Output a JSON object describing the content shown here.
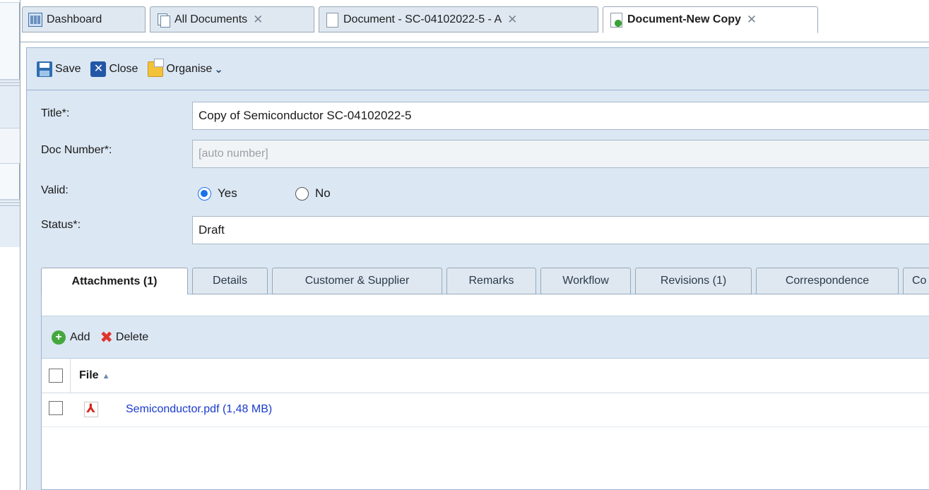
{
  "tabs": [
    {
      "label": "Dashboard",
      "icon": "dashboard-icon",
      "closable": false
    },
    {
      "label": "All Documents",
      "icon": "documents-icon",
      "closable": true
    },
    {
      "label": "Document - SC-04102022-5 - A",
      "icon": "document-icon",
      "closable": true
    },
    {
      "label": "Document-New Copy",
      "icon": "new-document-icon",
      "closable": true,
      "active": true
    }
  ],
  "close_glyph": "✕",
  "toolbar": {
    "save_label": "Save",
    "close_label": "Close",
    "organise_label": "Organise"
  },
  "form": {
    "title_label": "Title*:",
    "title_value": "Copy of Semiconductor SC-04102022-5",
    "doc_number_label": "Doc Number*:",
    "doc_number_placeholder": "[auto number]",
    "valid_label": "Valid:",
    "valid_options": [
      "Yes",
      "No"
    ],
    "valid_selected": "Yes",
    "status_label": "Status*:",
    "status_value": "Draft"
  },
  "inner_tabs": [
    {
      "label": "Attachments (1)",
      "active": true
    },
    {
      "label": "Details"
    },
    {
      "label": "Customer & Supplier"
    },
    {
      "label": "Remarks"
    },
    {
      "label": "Workflow"
    },
    {
      "label": "Revisions (1)"
    },
    {
      "label": "Correspondence"
    },
    {
      "label": "Co"
    }
  ],
  "attachments": {
    "add_label": "Add",
    "delete_label": "Delete",
    "column_file": "File",
    "rows": [
      {
        "file": "Semiconductor.pdf (1,48 MB)",
        "icon": "pdf-icon"
      }
    ]
  },
  "colors": {
    "panel_bg": "#dbe7f3",
    "link": "#1a3bcc",
    "accent_radio": "#1a73e8"
  }
}
